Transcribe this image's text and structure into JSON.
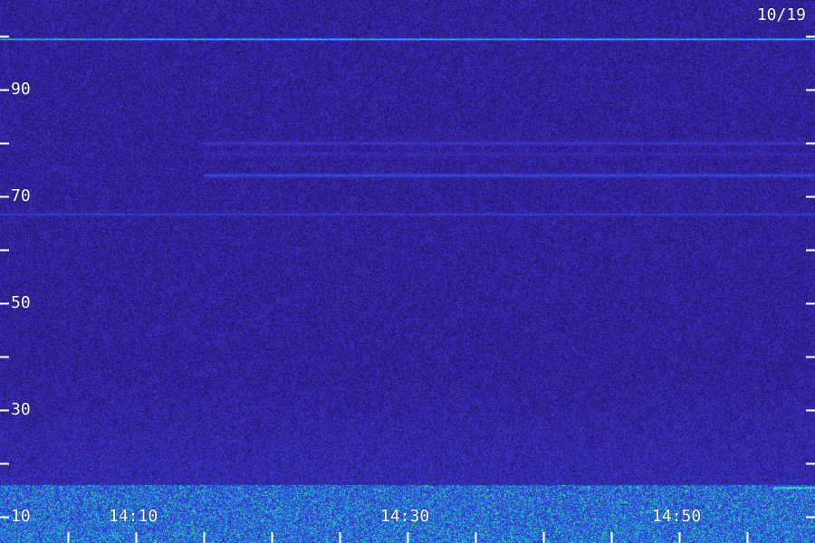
{
  "chart_data": {
    "type": "heatmap",
    "title": "",
    "date": "10/19",
    "xlabel": "",
    "ylabel": "",
    "x_range": [
      "14:00",
      "15:00"
    ],
    "x_tick_labels": [
      "14:10",
      "14:30",
      "14:50"
    ],
    "x_tick_every_minutes": 5,
    "y_range": [
      10,
      100
    ],
    "y_tick_labels": [
      "10",
      "30",
      "50",
      "70",
      "90"
    ],
    "y_tick_every": 10,
    "colormap": [
      "#1a0f4a",
      "#2b1a80",
      "#3a2ab8",
      "#2a50e0",
      "#20b0e8",
      "#30e890",
      "#60ff60"
    ],
    "features": [
      {
        "kind": "line",
        "y": 99.5,
        "start": "14:00",
        "end": "15:00",
        "intensity": 0.85
      },
      {
        "kind": "band",
        "y": 80,
        "start": "14:15",
        "end": "15:00",
        "intensity": 0.45
      },
      {
        "kind": "band",
        "y": 78,
        "start": "14:15",
        "end": "15:00",
        "intensity": 0.35
      },
      {
        "kind": "band",
        "y": 74,
        "start": "14:15",
        "end": "15:00",
        "intensity": 0.55
      },
      {
        "kind": "line",
        "y": 66.7,
        "start": "14:00",
        "end": "15:00",
        "intensity": 0.55
      },
      {
        "kind": "line",
        "y": 15.5,
        "start": "14:57",
        "end": "15:00",
        "intensity": 0.9
      },
      {
        "kind": "floor",
        "y_from": 10,
        "y_to": 16,
        "start": "14:00",
        "end": "15:00",
        "intensity": 0.75
      }
    ]
  }
}
